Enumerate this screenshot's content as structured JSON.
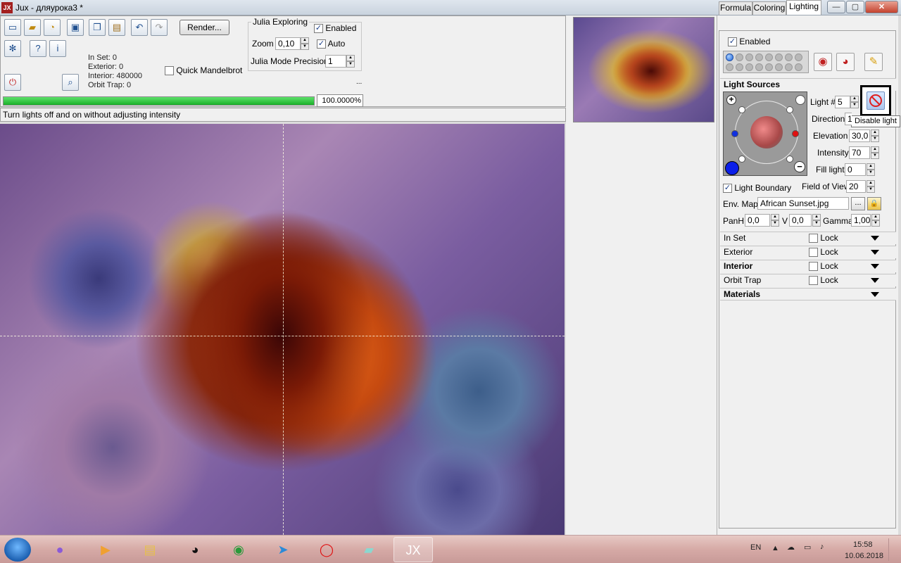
{
  "window": {
    "app_logo": "JX",
    "title": "Jux - дляурока3 *",
    "min": "—",
    "max": "▢",
    "close": "✕"
  },
  "toolbar": {
    "render_label": "Render...",
    "icons": [
      "new-file-icon",
      "open-folder-icon",
      "open-recent-icon",
      "save-icon",
      "copy-icon",
      "paste-icon",
      "undo-icon",
      "redo-icon",
      "settings-icon",
      "help-icon",
      "info-icon",
      "power-icon",
      "zoom-magnifier-icon"
    ]
  },
  "stats": {
    "in_set": "In Set: 0",
    "exterior": "Exterior: 0",
    "interior": "Interior: 480000",
    "orbit_trap": "Orbit Trap: 0"
  },
  "quick_mandelbrot": "Quick Mandelbrot",
  "julia": {
    "title": "Julia Exploring",
    "enabled_label": "Enabled",
    "zoom_label": "Zoom",
    "zoom_value": "0,10",
    "auto_label": "Auto",
    "precision_label": "Julia Mode Precision",
    "precision_value": "1"
  },
  "progress": {
    "value": "100.0000%",
    "percent": 100,
    "color": "#22b42e"
  },
  "ellipsis_small": "...",
  "status_text": "Turn lights off and on without adjusting intensity",
  "tabs": [
    "Formula",
    "Coloring",
    "Lighting"
  ],
  "lighting": {
    "enabled_label": "Enabled",
    "light_sources_title": "Light Sources",
    "light_num_label": "Light #",
    "light_num_value": "5",
    "direction_label": "Direction",
    "direction_value": "1",
    "elevation_label": "Elevation",
    "elevation_value": "30,0",
    "intensity_label": "Intensity",
    "intensity_value": "70",
    "fill_light_label": "Fill light",
    "fill_light_value": "0",
    "light_boundary_label": "Light Boundary",
    "fov_label": "Field of View",
    "fov_value": "20",
    "env_map_label": "Env. Map",
    "env_map_value": "African Sunset.jpg",
    "env_map_browse": "...",
    "panh_label": "PanH",
    "panh_value": "0,0",
    "v_label": "V",
    "v_value": "0,0",
    "gamma_label": "Gamma",
    "gamma_value": "1,00",
    "tooltip": "Disable light",
    "plus": "+",
    "minus": "−"
  },
  "sections": [
    {
      "label": "In Set",
      "lock": "Lock",
      "bold": false
    },
    {
      "label": "Exterior",
      "lock": "Lock",
      "bold": false
    },
    {
      "label": "Interior",
      "lock": "Lock",
      "bold": true
    },
    {
      "label": "Orbit Trap",
      "lock": "Lock",
      "bold": false
    },
    {
      "label": "Materials",
      "lock": "",
      "bold": true
    }
  ],
  "taskbar": {
    "language": "EN",
    "time": "15:58",
    "date": "10.06.2018",
    "apps": [
      "microphone-icon",
      "media-player-icon",
      "file-explorer-icon",
      "panda-icon",
      "chrome-icon",
      "telegram-icon",
      "opera-icon",
      "notes-icon",
      "jux-icon"
    ]
  }
}
